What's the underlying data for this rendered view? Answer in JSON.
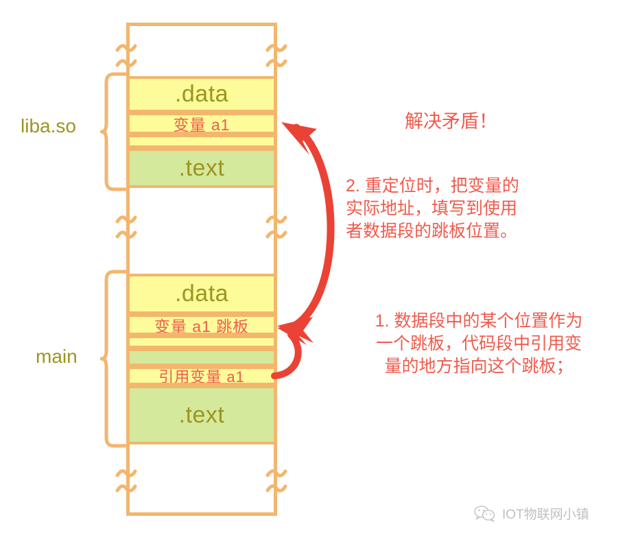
{
  "diagram": {
    "headline": "解决矛盾！",
    "modules": [
      {
        "name": "liba.so",
        "segments": [
          {
            "label": ".data",
            "kind": "title",
            "fill": "yellow"
          },
          {
            "label": "变量 a1",
            "kind": "note",
            "fill": "yellow"
          },
          {
            "label": "",
            "kind": "blank",
            "fill": "yellow"
          },
          {
            "label": ".text",
            "kind": "title",
            "fill": "green"
          }
        ]
      },
      {
        "name": "main",
        "segments": [
          {
            "label": ".data",
            "kind": "title",
            "fill": "yellow"
          },
          {
            "label": "变量 a1 跳板",
            "kind": "note",
            "fill": "yellow"
          },
          {
            "label": "",
            "kind": "blank",
            "fill": "yellow"
          },
          {
            "label": "",
            "kind": "blank",
            "fill": "green"
          },
          {
            "label": "引用变量 a1",
            "kind": "note",
            "fill": "yellow"
          },
          {
            "label": ".text",
            "kind": "title",
            "fill": "green"
          }
        ]
      }
    ],
    "annotations": [
      {
        "id": "step-2",
        "text": "2. 重定位时，把变量的\n实际地址，填写到使用\n者数据段的跳板位置。"
      },
      {
        "id": "step-1",
        "text": "1. 数据段中的某个位置作为\n一个跳板，代码段中引用变\n量的地方指向这个跳板；"
      }
    ],
    "labels": {
      "liba_so": "liba.so",
      "main": "main",
      "segment_data": ".data",
      "segment_text": ".text",
      "variable_a1": "变量 a1",
      "variable_a1_trampoline": "变量 a1 跳板",
      "reference_variable_a1": "引用变量 a1"
    },
    "colors": {
      "frame_border": "#f2b66d",
      "data_fill": "#fdfb9a",
      "text_fill": "#d5e99d",
      "segment_title": "#9c9520",
      "annotation_red": "#ef5b4c",
      "background": "#ffffff"
    },
    "icons": {
      "break_mark": "squiggle-break-icon",
      "brace_left": "curly-brace-icon",
      "arrow_relocation": "curved-arrow-icon",
      "arrow_trampoline": "curved-arrow-icon",
      "wechat": "wechat-icon"
    }
  },
  "watermark": {
    "text": "IOT物联网小镇"
  }
}
